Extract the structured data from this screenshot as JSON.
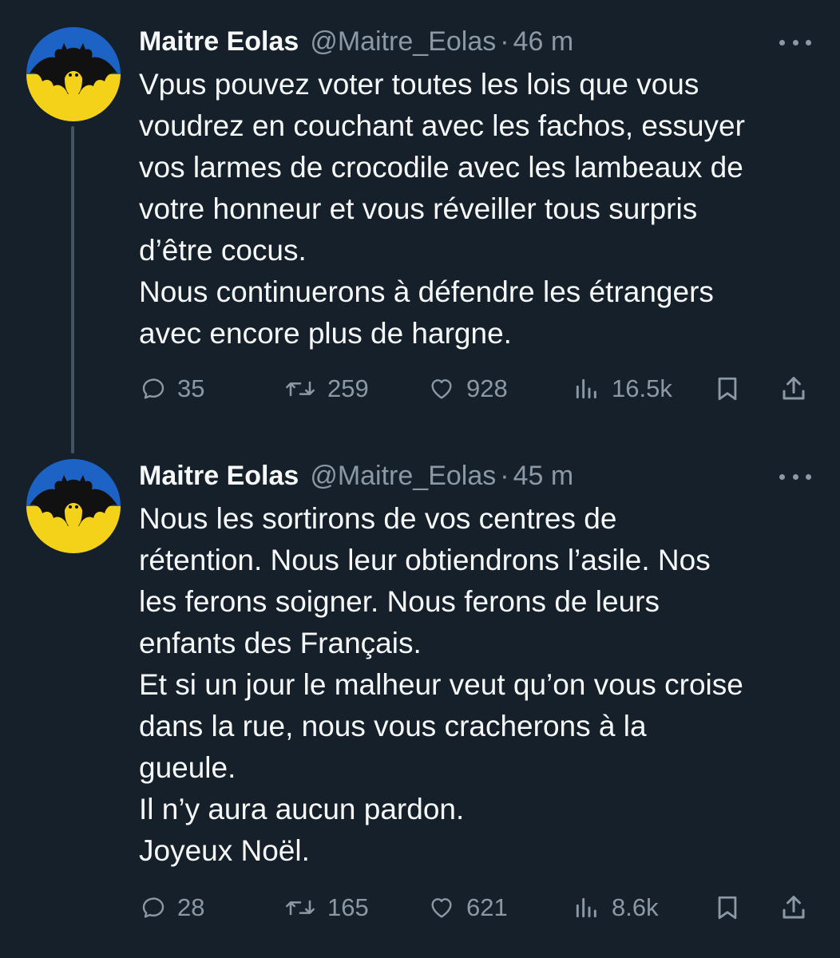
{
  "tweets": [
    {
      "author_name": "Maitre Eolas",
      "handle": "@Maitre_Eolas",
      "separator": "·",
      "time": "46 m",
      "avatar_icon": "bat-signal-avatar-icon",
      "lines": [
        "Vpus pouvez voter toutes les lois que vous",
        "voudrez en couchant avec les fachos, essuyer",
        "vos larmes de crocodile avec les lambeaux de",
        "votre honneur et vous réveiller tous surpris",
        "d’être cocus.",
        "Nous continuerons à défendre les étrangers",
        "avec encore plus de hargne."
      ],
      "replies": "35",
      "retweets": "259",
      "likes": "928",
      "views": "16.5k"
    },
    {
      "author_name": "Maitre Eolas",
      "handle": "@Maitre_Eolas",
      "separator": "·",
      "time": "45 m",
      "avatar_icon": "bat-signal-avatar-icon",
      "lines": [
        "Nous les sortirons de vos centres de",
        "rétention. Nous leur obtiendrons l’asile. Nos",
        "les ferons soigner. Nous ferons de leurs",
        "enfants des Français.",
        "Et si un jour le malheur veut qu’on vous croise",
        "dans la rue, nous vous cracherons à la",
        "gueule.",
        "Il n’y aura aucun pardon.",
        "Joyeux Noël."
      ],
      "replies": "28",
      "retweets": "165",
      "likes": "621",
      "views": "8.6k"
    }
  ],
  "icons": {
    "reply": "reply-icon",
    "retweet": "retweet-icon",
    "like": "heart-icon",
    "views": "views-icon",
    "bookmark": "bookmark-icon",
    "share": "share-icon",
    "more": "more-icon"
  },
  "colors": {
    "background": "#15202b",
    "text": "#f7f9f9",
    "secondary": "#8b98a5",
    "thread_line": "#425364",
    "avatar_blue": "#1d63c6",
    "avatar_yellow": "#f5d21a"
  }
}
